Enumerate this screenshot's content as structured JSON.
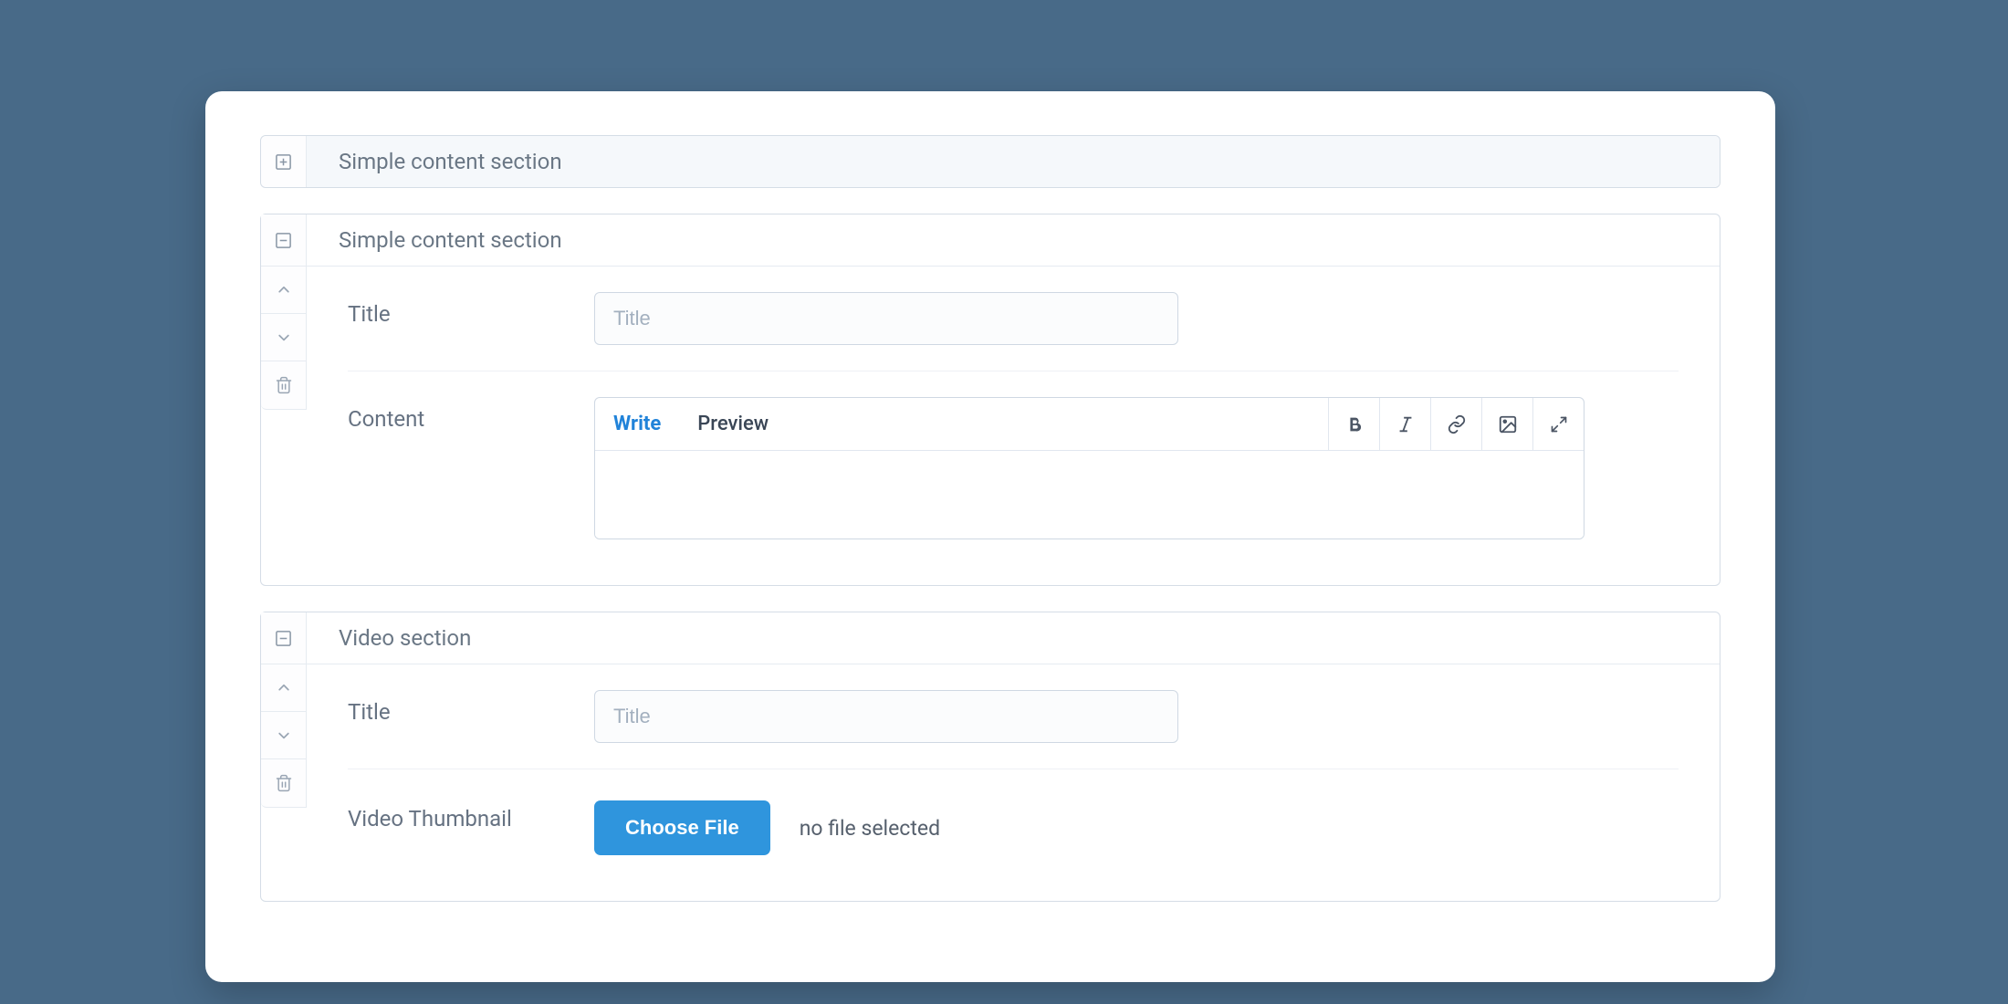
{
  "sections": {
    "add_new": {
      "title": "Simple content section"
    },
    "simple": {
      "title": "Simple content section",
      "fields": {
        "title_label": "Title",
        "title_placeholder": "Title",
        "content_label": "Content"
      },
      "editor": {
        "tabs": {
          "write": "Write",
          "preview": "Preview"
        }
      }
    },
    "video": {
      "title": "Video section",
      "fields": {
        "title_label": "Title",
        "title_placeholder": "Title",
        "thumb_label": "Video Thumbnail",
        "choose_btn": "Choose File",
        "no_file": "no file selected"
      }
    }
  }
}
